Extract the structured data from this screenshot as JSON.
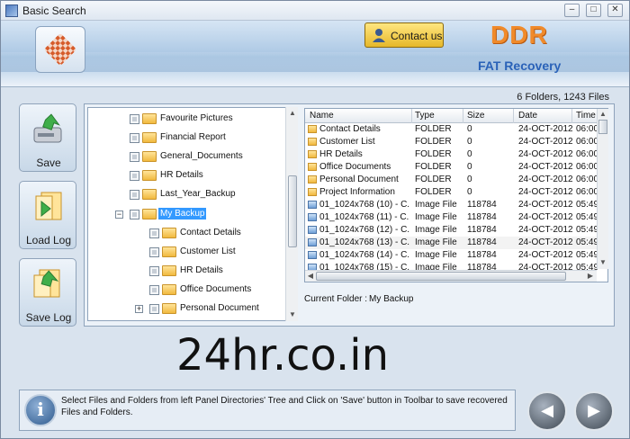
{
  "window": {
    "title": "Basic Search",
    "controls": {
      "minimize": "–",
      "maximize": "□",
      "close": "✕"
    }
  },
  "banner": {
    "contact_label": "Contact us",
    "brand": "DDR",
    "product": "FAT Recovery"
  },
  "counts": "6 Folders, 1243 Files",
  "sidebar": {
    "save": "Save",
    "load_log": "Load Log",
    "save_log": "Save Log"
  },
  "tree": {
    "items": [
      {
        "label": "Favourite Pictures",
        "level": 1
      },
      {
        "label": "Financial Report",
        "level": 1
      },
      {
        "label": "General_Documents",
        "level": 1
      },
      {
        "label": "HR Details",
        "level": 1
      },
      {
        "label": "Last_Year_Backup",
        "level": 1
      },
      {
        "label": "My Backup",
        "level": 1,
        "selected": true,
        "expanded": true
      },
      {
        "label": "Contact Details",
        "level": 2
      },
      {
        "label": "Customer List",
        "level": 2
      },
      {
        "label": "HR Details",
        "level": 2
      },
      {
        "label": "Office Documents",
        "level": 2
      },
      {
        "label": "Personal Document",
        "level": 2,
        "collapsed": true
      }
    ]
  },
  "list": {
    "columns": [
      "Name",
      "Type",
      "Size",
      "Date",
      "Time"
    ],
    "rows": [
      {
        "icon": "folder",
        "name": "Contact Details",
        "type": "FOLDER",
        "size": "0",
        "date": "24-OCT-2012",
        "time": "06:00"
      },
      {
        "icon": "folder",
        "name": "Customer List",
        "type": "FOLDER",
        "size": "0",
        "date": "24-OCT-2012",
        "time": "06:00"
      },
      {
        "icon": "folder",
        "name": "HR Details",
        "type": "FOLDER",
        "size": "0",
        "date": "24-OCT-2012",
        "time": "06:00"
      },
      {
        "icon": "folder",
        "name": "Office Documents",
        "type": "FOLDER",
        "size": "0",
        "date": "24-OCT-2012",
        "time": "06:00"
      },
      {
        "icon": "folder",
        "name": "Personal Document",
        "type": "FOLDER",
        "size": "0",
        "date": "24-OCT-2012",
        "time": "06:00"
      },
      {
        "icon": "folder",
        "name": "Project Information",
        "type": "FOLDER",
        "size": "0",
        "date": "24-OCT-2012",
        "time": "06:00"
      },
      {
        "icon": "image",
        "name": "01_1024x768 (10) - C...",
        "type": "Image File",
        "size": "118784",
        "date": "24-OCT-2012",
        "time": "05:49"
      },
      {
        "icon": "image",
        "name": "01_1024x768 (11) - C...",
        "type": "Image File",
        "size": "118784",
        "date": "24-OCT-2012",
        "time": "05:49"
      },
      {
        "icon": "image",
        "name": "01_1024x768 (12) - C...",
        "type": "Image File",
        "size": "118784",
        "date": "24-OCT-2012",
        "time": "05:49"
      },
      {
        "icon": "image",
        "name": "01_1024x768 (13) - C...",
        "type": "Image File",
        "size": "118784",
        "date": "24-OCT-2012",
        "time": "05:49"
      },
      {
        "icon": "image",
        "name": "01_1024x768 (14) - C...",
        "type": "Image File",
        "size": "118784",
        "date": "24-OCT-2012",
        "time": "05:49"
      },
      {
        "icon": "image",
        "name": "01_1024x768 (15) - C...",
        "type": "Image File",
        "size": "118784",
        "date": "24-OCT-2012",
        "time": "05:49"
      }
    ]
  },
  "current_folder": {
    "label": "Current Folder :",
    "value": "My Backup"
  },
  "watermark": "24hr.co.in",
  "status": {
    "text": "Select Files and Folders from left Panel Directories' Tree and Click on 'Save' button in Toolbar to save recovered Files and Folders."
  },
  "icons": {
    "info": "i",
    "back": "◀",
    "next": "▶"
  },
  "colors": {
    "brand": "#f08a2a",
    "product": "#2a62b8",
    "selection": "#3399ff",
    "contact_button": "#e6b82a"
  }
}
